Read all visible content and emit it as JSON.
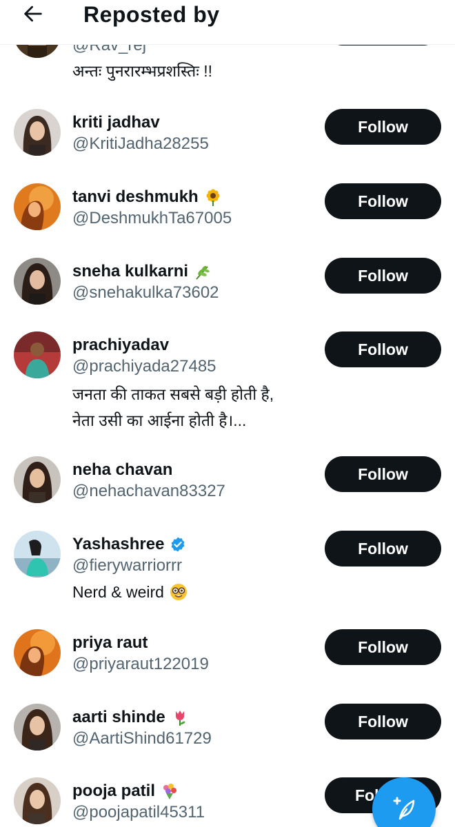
{
  "header": {
    "title": "Reposted by",
    "back_icon": "arrow-left-icon"
  },
  "partial_user": {
    "handle": "@Rav_rej",
    "bio": "अन्तः पुनरारम्भप्रशस्तिः !!"
  },
  "users": [
    {
      "name": "kriti jadhav",
      "handle": "@KritiJadha28255",
      "emoji": "",
      "verified": false,
      "bio": [],
      "follow_label": "Follow"
    },
    {
      "name": "tanvi deshmukh",
      "handle": "@DeshmukhTa67005",
      "emoji": "sunflower",
      "verified": false,
      "bio": [],
      "follow_label": "Follow"
    },
    {
      "name": "sneha kulkarni",
      "handle": "@snehakulka73602",
      "emoji": "herb",
      "verified": false,
      "bio": [],
      "follow_label": "Follow"
    },
    {
      "name": "prachiyadav",
      "handle": "@prachiyada27485",
      "emoji": "",
      "verified": false,
      "bio": [
        "जनता की ताकत सबसे बड़ी होती है,",
        "नेता उसी का आईना होती है।..."
      ],
      "follow_label": "Follow"
    },
    {
      "name": "neha chavan",
      "handle": "@nehachavan83327",
      "emoji": "",
      "verified": false,
      "bio": [],
      "follow_label": "Follow"
    },
    {
      "name": "Yashashree",
      "handle": "@fierywarriorrr",
      "emoji": "",
      "verified": true,
      "bio": [
        "Nerd & weird"
      ],
      "bio_emoji": "nerd-face",
      "follow_label": "Follow"
    },
    {
      "name": "priya raut",
      "handle": "@priyaraut122019",
      "emoji": "",
      "verified": false,
      "bio": [],
      "follow_label": "Follow"
    },
    {
      "name": "aarti shinde",
      "handle": "@AartiShind61729",
      "emoji": "tulip",
      "verified": false,
      "bio": [],
      "follow_label": "Follow"
    },
    {
      "name": "pooja patil",
      "handle": "@poojapatil45311",
      "emoji": "bouquet",
      "verified": false,
      "bio": [],
      "follow_label": "Follow"
    }
  ],
  "fab": {
    "icon": "compose-feather-icon"
  },
  "colors": {
    "follow_bg": "#0f1419",
    "handle": "#536471",
    "accent": "#1d9bf0",
    "verified": "#1d9bf0"
  }
}
